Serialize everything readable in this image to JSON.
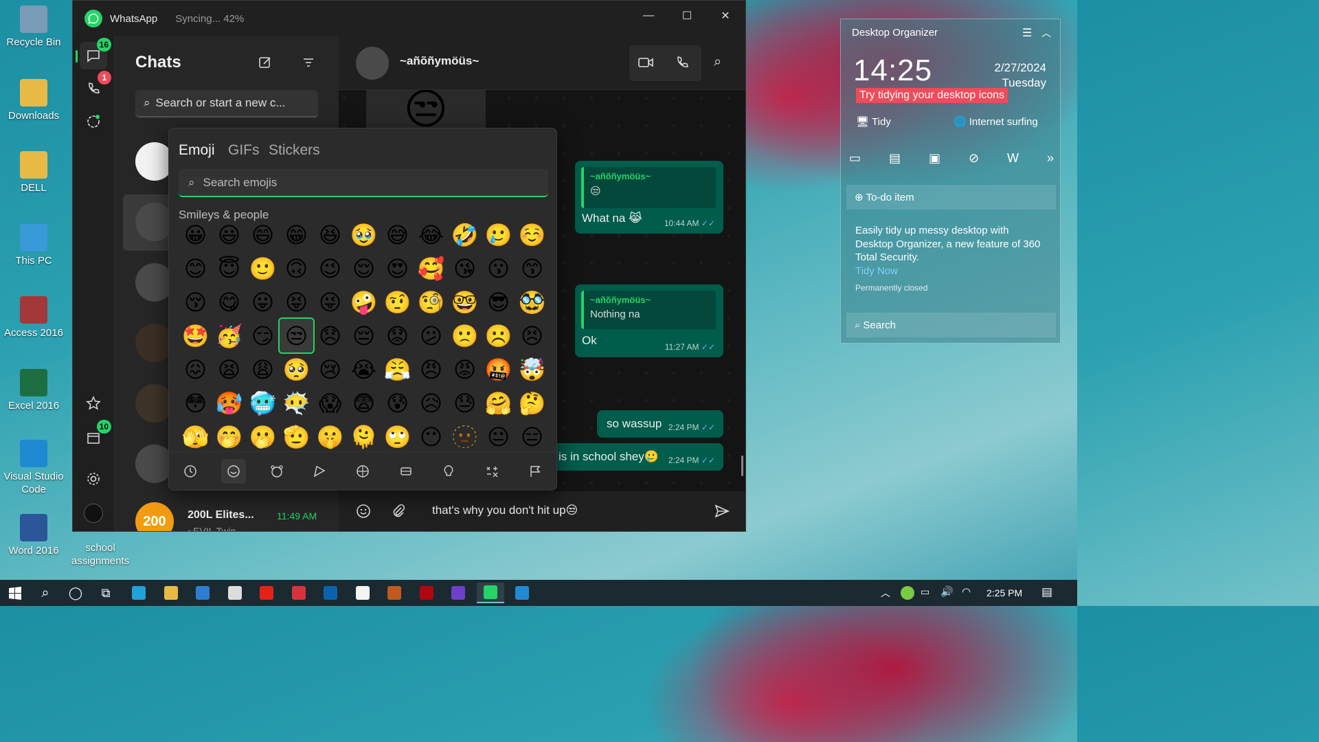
{
  "desktop": {
    "icons": [
      {
        "label": "Recycle Bin",
        "icon": "recycle-bin-icon",
        "color": "#7a9bb5"
      },
      {
        "label": "Downloads",
        "icon": "downloads-folder-icon",
        "color": "#e9b945"
      },
      {
        "label": "DELL",
        "icon": "user-folder-icon",
        "color": "#e9b945"
      },
      {
        "label": "This PC",
        "icon": "computer-icon",
        "color": "#3a9ad9"
      },
      {
        "label": "Access 2016",
        "icon": "access-icon",
        "color": "#a4373a"
      },
      {
        "label": "Excel 2016",
        "icon": "excel-icon",
        "color": "#1d6f42"
      },
      {
        "label": "Visual Studio Code",
        "icon": "vscode-icon",
        "color": "#1f8ad2"
      },
      {
        "label": "Word 2016",
        "icon": "word-icon",
        "color": "#2b579a"
      }
    ],
    "extra_icon": {
      "label": "school assignments",
      "icon": "folder-icon"
    }
  },
  "whatsapp": {
    "title": "WhatsApp",
    "sync_status": "Syncing... 42%",
    "window_controls": {
      "minimize": "—",
      "maximize": "☐",
      "close": "✕"
    },
    "rail": {
      "chats_badge": "16",
      "calls_badge": "1",
      "archived_badge": "10"
    },
    "chatlist": {
      "title": "Chats",
      "search_placeholder": "Search or start a new c...",
      "bottom_chat": {
        "name": "200L Elites...",
        "time": "11:49 AM",
        "preview": "~EVIL Twin",
        "avatar_text": "200"
      }
    },
    "chat": {
      "contact_name": "~añõñymöüs~",
      "messages": [
        {
          "quote_name": "~añõñymöüs~",
          "quote_text": "😒",
          "text": "What na 😹",
          "time": "10:44 AM"
        },
        {
          "quote_name": "~añõñymöüs~",
          "quote_text": "Nothing na",
          "text": "Ok",
          "time": "11:27 AM"
        },
        {
          "text": "so wassup",
          "time": "2:24 PM"
        },
        {
          "text": "is in school shey🥲",
          "time": "2:24 PM"
        }
      ],
      "top_emoji": "😒",
      "composer_text": "that's why you don't hit up😒"
    },
    "emoji_panel": {
      "tabs": [
        "Emoji",
        "GIFs",
        "Stickers"
      ],
      "search_placeholder": "Search emojis",
      "section": "Smileys & people",
      "emojis": [
        "😀",
        "😃",
        "😄",
        "😁",
        "😆",
        "🥹",
        "😅",
        "😂",
        "🤣",
        "🥲",
        "☺️",
        "😊",
        "😇",
        "🙂",
        "🙃",
        "😉",
        "😌",
        "😍",
        "🥰",
        "😘",
        "😗",
        "😙",
        "😚",
        "😋",
        "😛",
        "😝",
        "😜",
        "🤪",
        "🤨",
        "🧐",
        "🤓",
        "😎",
        "🥸",
        "🤩",
        "🥳",
        "😏",
        "😒",
        "😞",
        "😔",
        "😟",
        "😕",
        "🙁",
        "☹️",
        "😣",
        "😖",
        "😫",
        "😩",
        "🥺",
        "😢",
        "😭",
        "😤",
        "😠",
        "😡",
        "🤬",
        "🤯",
        "😳",
        "🥵",
        "🥶",
        "😶‍🌫️",
        "😱",
        "😨",
        "😰",
        "😥",
        "😓",
        "🤗",
        "🤔",
        "🫣",
        "🤭",
        "🫢",
        "🫡",
        "🤫",
        "🫠",
        "🙄",
        "😶",
        "🫥",
        "😐",
        "😑"
      ],
      "selected_index": 36
    }
  },
  "organizer": {
    "title": "Desktop Organizer",
    "clock": "14:25",
    "date": "2/27/2024",
    "weekday": "Tuesday",
    "tip": "Try tidying your desktop icons",
    "tidy_label": "Tidy",
    "surf_label": "Internet surfing",
    "todo_label": "To-do item",
    "description": "Easily tidy up messy desktop with Desktop Organizer, a new feature of 360 Total Security.",
    "tidy_now": "Tidy Now",
    "closed": "Permanently closed",
    "search_label": "Search"
  },
  "taskbar": {
    "time": "2:25 PM",
    "apps": [
      {
        "icon": "edge-icon",
        "color": "#1fa3d8"
      },
      {
        "icon": "file-explorer-icon",
        "color": "#e9b945"
      },
      {
        "icon": "store-icon",
        "color": "#2d7dd2"
      },
      {
        "icon": "mail-icon",
        "color": "#dddddd"
      },
      {
        "icon": "youtube-icon",
        "color": "#e62117"
      },
      {
        "icon": "mail-red-icon",
        "color": "#d9323f"
      },
      {
        "icon": "outlook-icon",
        "color": "#0a64ad"
      },
      {
        "icon": "word-icon",
        "color": "#f4f4f4"
      },
      {
        "icon": "app-icon",
        "color": "#c05a1e"
      },
      {
        "icon": "netflix-icon",
        "color": "#b00710"
      },
      {
        "icon": "github-icon",
        "color": "#6e40c9"
      },
      {
        "icon": "whatsapp-icon",
        "color": "#25d366"
      },
      {
        "icon": "vscode-icon",
        "color": "#1f8ad2"
      }
    ]
  }
}
